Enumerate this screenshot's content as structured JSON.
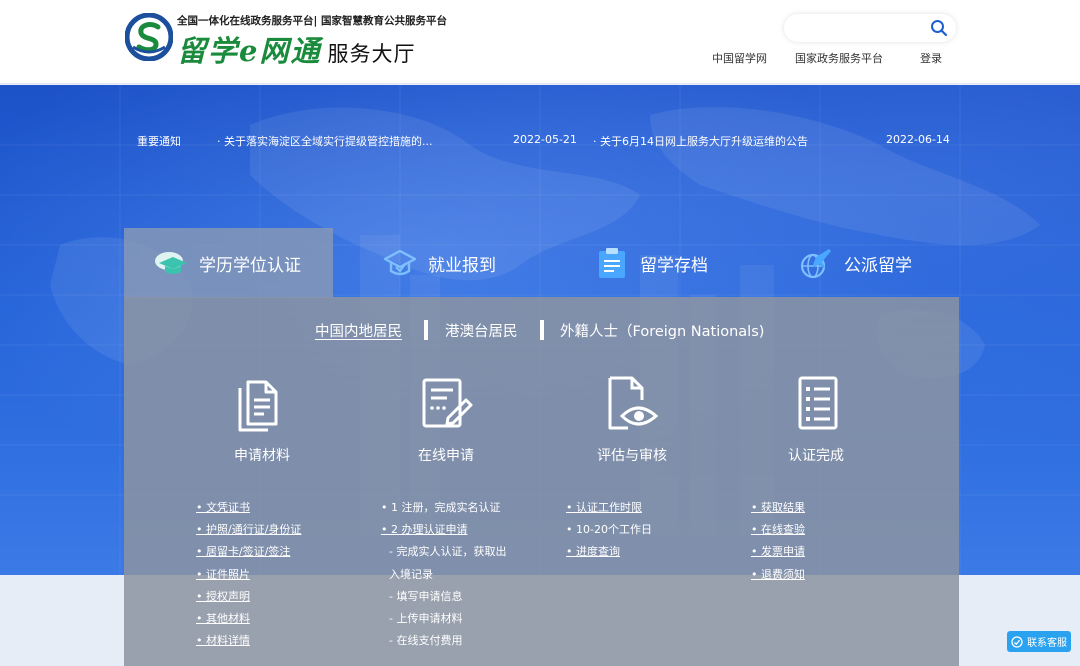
{
  "header": {
    "logo_top": "全国一体化在线政务服务平台| 国家智慧教育公共服务平台",
    "logo_brand": "留学e网通",
    "logo_sub": "服务大厅",
    "search": {
      "placeholder": ""
    },
    "nav": [
      "中国留学网",
      "国家政务服务平台",
      "登录"
    ]
  },
  "notices": {
    "label": "重要通知",
    "items": [
      {
        "text": "· 关于落实海淀区全域实行提级管控措施的...",
        "date": "2022-05-21"
      },
      {
        "text": "· 关于6月14日网上服务大厅升级运维的公告",
        "date": "2022-06-14"
      }
    ]
  },
  "tabs": [
    {
      "label": "学历学位认证",
      "icon": "graduation-cap-icon",
      "active": true
    },
    {
      "label": "就业报到",
      "icon": "employment-icon",
      "active": false
    },
    {
      "label": "留学存档",
      "icon": "archive-document-icon",
      "active": false
    },
    {
      "label": "公派留学",
      "icon": "airplane-globe-icon",
      "active": false
    }
  ],
  "subtabs": [
    {
      "label": "中国内地居民",
      "active": true
    },
    {
      "label": "港澳台居民",
      "active": false
    },
    {
      "label": "外籍人士（Foreign Nationals)",
      "active": false
    }
  ],
  "steps": [
    {
      "title": "申请材料",
      "icon": "documents-icon",
      "items": [
        "• 文凭证书",
        "• 护照/通行证/身份证",
        "• 居留卡/签证/签注",
        "• 证件照片",
        "• 授权声明",
        "• 其他材料",
        "• 材料详情"
      ]
    },
    {
      "title": "在线申请",
      "icon": "online-form-icon",
      "items": [
        "• 1 注册，完成实名认证",
        "• 2 办理认证申请",
        "- 完成实人认证，获取出",
        "入境记录",
        "- 填写申请信息",
        "- 上传申请材料",
        "- 在线支付费用"
      ]
    },
    {
      "title": "评估与审核",
      "icon": "review-eye-icon",
      "items": [
        "• 认证工作时限",
        "• 10-20个工作日",
        "• 进度查询"
      ]
    },
    {
      "title": "认证完成",
      "icon": "checklist-icon",
      "items": [
        "• 获取结果",
        "• 在线查验",
        "• 发票申请",
        "• 退费须知"
      ]
    }
  ],
  "service_button": "联系客服",
  "colors": {
    "brand_green": "#1a8a3c",
    "hero_blue": "#2463d9",
    "service_blue": "#2aa2ef"
  }
}
